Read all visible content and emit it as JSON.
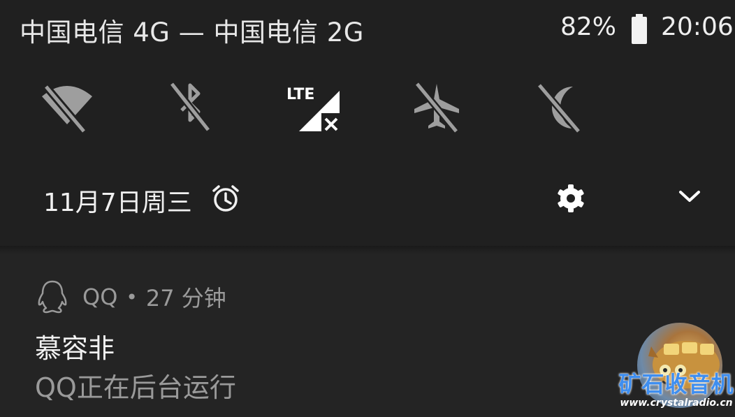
{
  "status_bar": {
    "carrier_text": "中国电信 4G — 中国电信 2G",
    "battery_percent": "82%",
    "battery_level": 0.82,
    "time": "20:06"
  },
  "quick_settings": {
    "tiles": [
      {
        "icon": "wifi-off-icon",
        "state": "off"
      },
      {
        "icon": "bluetooth-off-icon",
        "state": "off"
      },
      {
        "icon": "mobile-data-lte-off-icon",
        "label": "LTE",
        "state": "on"
      },
      {
        "icon": "airplane-mode-off-icon",
        "state": "off"
      },
      {
        "icon": "do-not-disturb-off-icon",
        "state": "off"
      }
    ],
    "date": "11月7日周三",
    "alarm_icon": "alarm-clock-icon",
    "settings_icon": "gear-icon",
    "expand_icon": "chevron-down-icon"
  },
  "notification": {
    "app_icon": "qq-penguin-icon",
    "app_name": "QQ",
    "separator": "•",
    "time_ago": "27 分钟",
    "title": "慕容非",
    "text": "QQ正在后台运行"
  },
  "watermark": {
    "main": "矿石收音机",
    "sub": "www.crystalradio.cn"
  },
  "colors": {
    "background": "#202020",
    "notification_bg": "#242424",
    "icon_off": "#9e9e9e",
    "icon_on": "#ffffff",
    "secondary_text": "#9a9a9a",
    "watermark_blue": "#3e8ef0"
  }
}
